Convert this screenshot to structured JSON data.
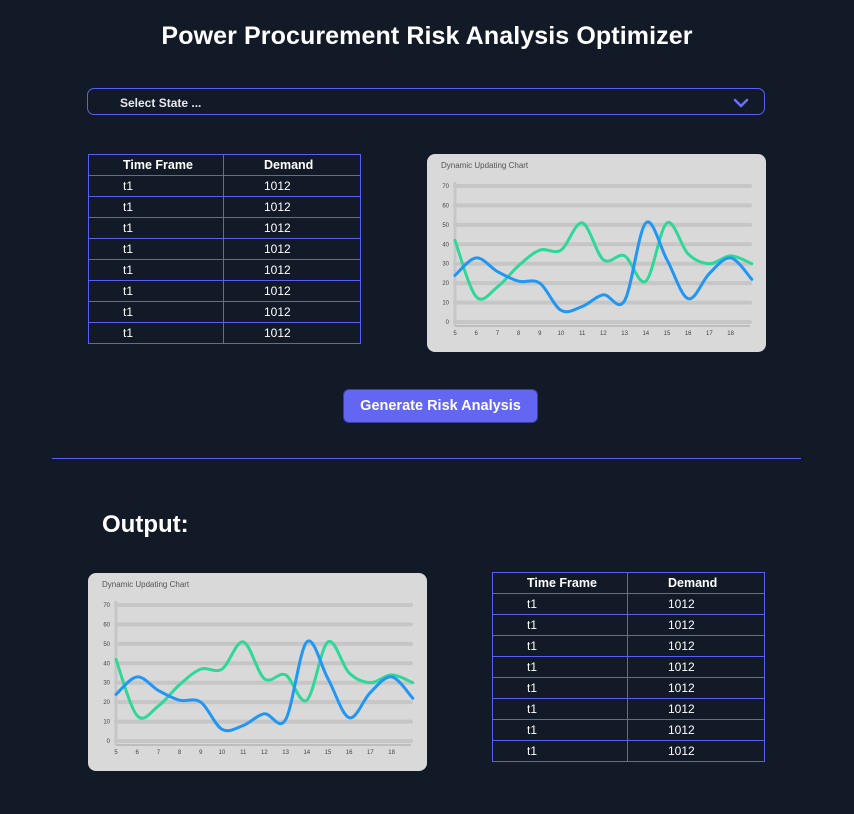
{
  "page": {
    "title": "Power Procurement Risk Analysis Optimizer"
  },
  "state_select": {
    "placeholder": "Select State ..."
  },
  "input_table": {
    "headers": [
      "Time Frame",
      "Demand"
    ],
    "rows": [
      [
        "t1",
        "1012"
      ],
      [
        "t1",
        "1012"
      ],
      [
        "t1",
        "1012"
      ],
      [
        "t1",
        "1012"
      ],
      [
        "t1",
        "1012"
      ],
      [
        "t1",
        "1012"
      ],
      [
        "t1",
        "1012"
      ],
      [
        "t1",
        "1012"
      ]
    ]
  },
  "generate_button": {
    "label": "Generate Risk Analysis"
  },
  "output": {
    "heading": "Output:"
  },
  "output_table": {
    "headers": [
      "Time Frame",
      "Demand"
    ],
    "rows": [
      [
        "t1",
        "1012"
      ],
      [
        "t1",
        "1012"
      ],
      [
        "t1",
        "1012"
      ],
      [
        "t1",
        "1012"
      ],
      [
        "t1",
        "1012"
      ],
      [
        "t1",
        "1012"
      ],
      [
        "t1",
        "1012"
      ],
      [
        "t1",
        "1012"
      ]
    ]
  },
  "colors": {
    "background": "#111a26",
    "accent": "#6366f1",
    "series_blue": "#2196f3",
    "series_green": "#2ed899",
    "chart_bg": "#d9d9d9"
  },
  "icons": {
    "dropdown": "chevron-down-icon"
  },
  "chart_data": [
    {
      "type": "line",
      "title": "Dynamic Updating Chart",
      "x": [
        5,
        6,
        7,
        8,
        9,
        10,
        11,
        12,
        13,
        14,
        15,
        16,
        17,
        18
      ],
      "ylim": [
        0,
        70
      ],
      "yticks": [
        0,
        10,
        20,
        30,
        40,
        50,
        60,
        70
      ],
      "grid": true,
      "series": [
        {
          "color": "#2ed899",
          "values": [
            42,
            13,
            18,
            29,
            37,
            37,
            51,
            32,
            34,
            21,
            51,
            35,
            30,
            34,
            30
          ]
        },
        {
          "color": "#2196f3",
          "values": [
            24,
            33,
            26,
            21,
            20,
            6,
            8,
            14,
            11,
            51,
            32,
            12,
            25,
            33,
            22
          ]
        }
      ]
    },
    {
      "type": "line",
      "title": "Dynamic Updating Chart",
      "x": [
        5,
        6,
        7,
        8,
        9,
        10,
        11,
        12,
        13,
        14,
        15,
        16,
        17,
        18
      ],
      "ylim": [
        0,
        70
      ],
      "yticks": [
        0,
        10,
        20,
        30,
        40,
        50,
        60,
        70
      ],
      "grid": true,
      "series": [
        {
          "color": "#2ed899",
          "values": [
            42,
            13,
            18,
            29,
            37,
            37,
            51,
            32,
            34,
            21,
            51,
            35,
            30,
            34,
            30
          ]
        },
        {
          "color": "#2196f3",
          "values": [
            24,
            33,
            26,
            21,
            20,
            6,
            8,
            14,
            11,
            51,
            32,
            12,
            25,
            33,
            22
          ]
        }
      ]
    }
  ]
}
